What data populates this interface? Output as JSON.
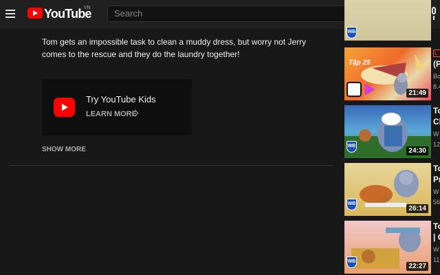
{
  "header": {
    "logo_text": "YouTube",
    "country_code": "VN",
    "search_placeholder": "Search"
  },
  "description": {
    "text": "Tom gets an impossible task to clean a muddy dress, but worry not Jerry comes to the rescue and they do the laundry together!"
  },
  "kids_promo": {
    "title": "Try YouTube Kids",
    "learn_more": "LEARN MORE"
  },
  "show_more_label": "SHOW MORE",
  "colors": {
    "background": "#181818",
    "header": "#202020",
    "brand_red": "#ff0000",
    "text_secondary": "#aaaaaa"
  },
  "recommendations": [
    {
      "title_line1": "",
      "title_line2": "",
      "channel": "",
      "meta": "",
      "duration": "",
      "partial": true
    },
    {
      "title_line1": "",
      "title_line2": "(P",
      "channel": "Bo",
      "meta": "8.4",
      "duration": "21:49",
      "episode_tag": "Tập 25",
      "live_badge": "L"
    },
    {
      "title_line1": "To",
      "title_line2": "Ch",
      "channel": "W",
      "meta": "12",
      "duration": "24:30",
      "badge": "WB"
    },
    {
      "title_line1": "To",
      "title_line2": "Pr",
      "channel": "W",
      "meta": "56",
      "duration": "26:14",
      "badge": "WB"
    },
    {
      "title_line1": "To",
      "title_line2": "| C",
      "channel": "W",
      "meta": "11",
      "duration": "22:27",
      "badge": "WB"
    }
  ],
  "icons": {
    "menu": "hamburger-icon",
    "search": "magnifier-icon",
    "mic": "microphone-icon",
    "kids": "youtube-kids-icon"
  }
}
